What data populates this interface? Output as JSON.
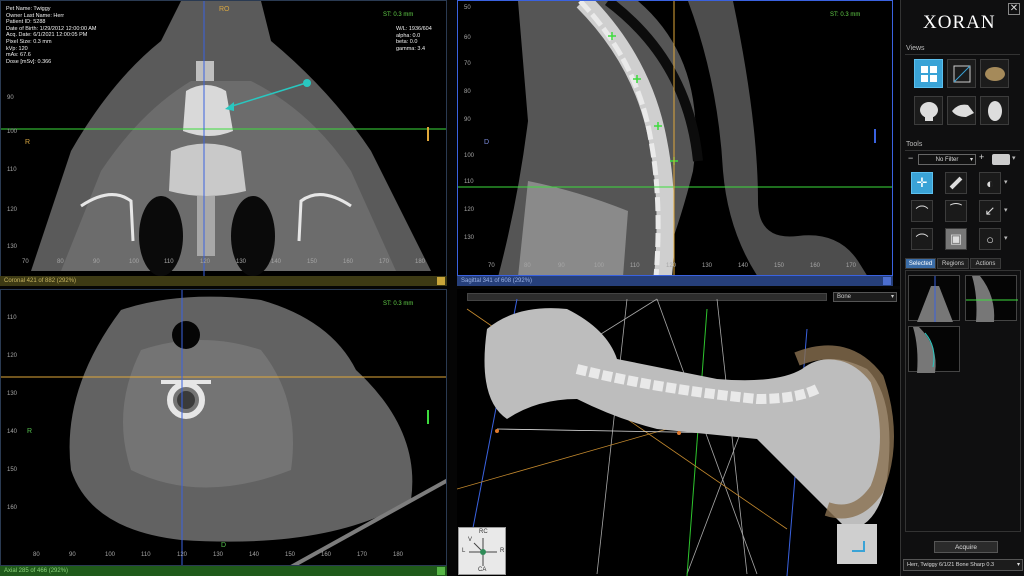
{
  "patient_info": {
    "lines": [
      "Pet Name: Twiggy",
      "Owner Last Name: Herr",
      "Patient ID: 5288",
      "Date of Birth: 1/29/2012 12:00:00 AM",
      "Acq. Date: 6/1/2021 12:00:05 PM",
      "Pixel Size: 0.3 mm",
      "kVp: 120",
      "mAs: 67.6",
      "Dose [mSv]: 0.366"
    ]
  },
  "window_info": {
    "lines": [
      "W/L: 1936/604",
      "alpha: 0.0",
      "beta: 0.0",
      "gamma: 3.4"
    ]
  },
  "viewports": {
    "coronal": {
      "st_label": "ST: 0.3 mm",
      "top_label": "RO",
      "left_label": "R",
      "axis_left": [
        "90",
        "100",
        "110",
        "120",
        "130"
      ],
      "axis_bottom": [
        "70",
        "80",
        "90",
        "100",
        "110",
        "120",
        "130",
        "140",
        "150",
        "160",
        "170",
        "180"
      ],
      "status": "Coronal 421 of 882 (292%)"
    },
    "sagittal": {
      "st_label": "ST: 0.3 mm",
      "left_label": "D",
      "axis_left": [
        "50",
        "60",
        "70",
        "80",
        "90",
        "100",
        "110",
        "120",
        "130"
      ],
      "axis_bottom": [
        "70",
        "80",
        "90",
        "100",
        "110",
        "120",
        "130",
        "140",
        "150",
        "160",
        "170"
      ],
      "status": "Sagittal 341 of 608 (292%)"
    },
    "axial": {
      "st_label": "ST: 0.3 mm",
      "left_label": "R",
      "bottom_label": "D",
      "axis_left": [
        "110",
        "120",
        "130",
        "140",
        "150",
        "160"
      ],
      "axis_bottom": [
        "80",
        "90",
        "100",
        "110",
        "120",
        "130",
        "140",
        "150",
        "160",
        "170",
        "180"
      ],
      "status": "Axial 285 of 466 (292%)"
    },
    "volume": {
      "preset": "Bone",
      "cube_labels": {
        "top": "RC",
        "left": "L",
        "right": "R",
        "bottom": "CA",
        "v": "V"
      }
    }
  },
  "panel": {
    "brand": "XORAN",
    "views_title": "Views",
    "tools_title": "Tools",
    "filter_value": "No Filter",
    "tabs": [
      "Selected",
      "Regions",
      "Actions"
    ],
    "acquire_label": "Acquire",
    "series_value": "Herr, Twiggy 6/1/21 Bone Sharp 0.3"
  },
  "colors": {
    "panel_accent": "#3aa3d6",
    "crosshair_green": "#3ddc3d",
    "crosshair_orange": "#e0a83a",
    "crosshair_blue": "#3a62e0"
  }
}
